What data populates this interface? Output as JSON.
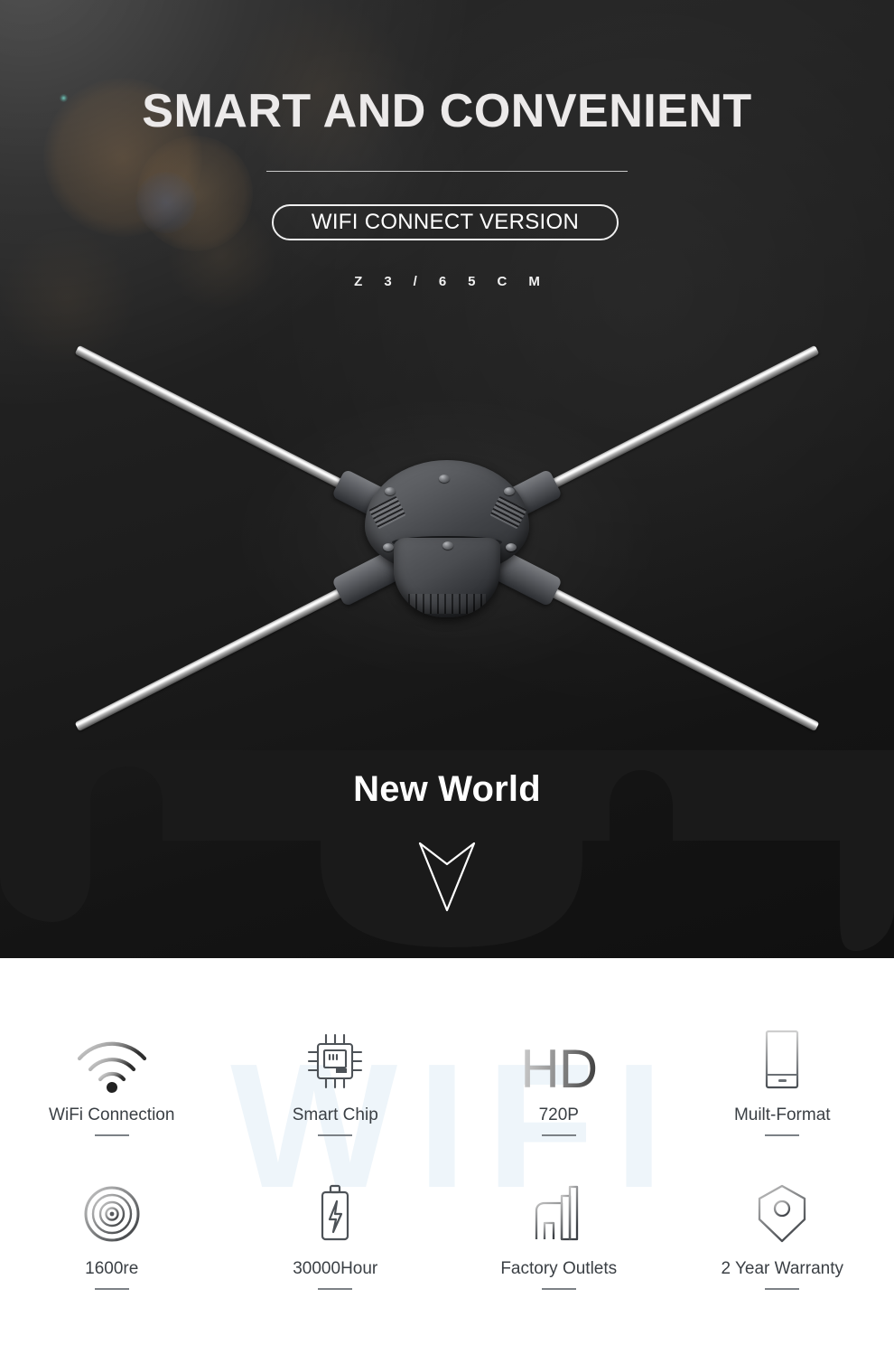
{
  "hero": {
    "title": "SMART AND CONVENIENT",
    "badge_label": "WIFI CONNECT VERSION",
    "model_code": "Z3/65CM",
    "tagline": "New World",
    "scroll_arrow_icon": "chevron-down-arrow-icon",
    "device_icon": "hologram-fan-device"
  },
  "watermark": {
    "text": "WIFI"
  },
  "features": {
    "row1": [
      {
        "label": "WiFi Connection",
        "icon": "wifi-icon"
      },
      {
        "label": "Smart Chip",
        "icon": "cpu-chip-icon"
      },
      {
        "label": "720P",
        "icon": "hd-icon",
        "icon_text": "HD"
      },
      {
        "label": "Muilt-Format",
        "icon": "mobile-device-icon"
      }
    ],
    "row2": [
      {
        "label": "1600re",
        "icon": "disc-spiral-icon"
      },
      {
        "label": "30000Hour",
        "icon": "battery-bolt-icon"
      },
      {
        "label": "Factory Outlets",
        "icon": "factory-icon"
      },
      {
        "label": "2 Year Warranty",
        "icon": "shield-keyhole-icon"
      }
    ]
  },
  "colors": {
    "hero_background": "#1c1c1c",
    "hero_text": "#ffffff",
    "features_background": "#ffffff",
    "label_text": "#3a3f44",
    "watermark": "#eef5fa",
    "dash": "#7c8186"
  }
}
